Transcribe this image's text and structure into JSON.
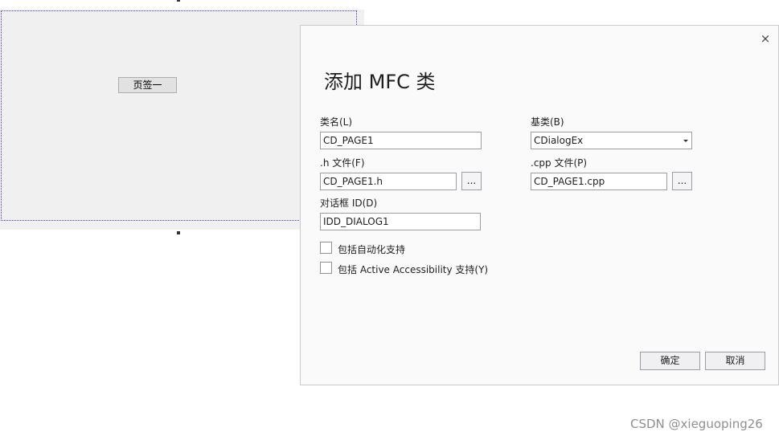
{
  "canvas": {
    "page_button_label": "页签一"
  },
  "dialog": {
    "close_glyph": "×",
    "title": "添加 MFC 类",
    "class_name": {
      "label": "类名(L)",
      "value": "CD_PAGE1"
    },
    "base_class": {
      "label": "基类(B)",
      "value": "CDialogEx"
    },
    "h_file": {
      "label": ".h 文件(F)",
      "value": "CD_PAGE1.h",
      "browse_label": "..."
    },
    "cpp_file": {
      "label": ".cpp 文件(P)",
      "value": "CD_PAGE1.cpp",
      "browse_label": "..."
    },
    "dialog_id": {
      "label": "对话框 ID(D)",
      "value": "IDD_DIALOG1"
    },
    "checkboxes": [
      {
        "label": "包括自动化支持",
        "checked": false
      },
      {
        "label": "包括 Active Accessibility 支持(Y)",
        "checked": false
      }
    ],
    "ok_label": "确定",
    "cancel_label": "取消"
  },
  "watermark": "CSDN @xieguoping26"
}
